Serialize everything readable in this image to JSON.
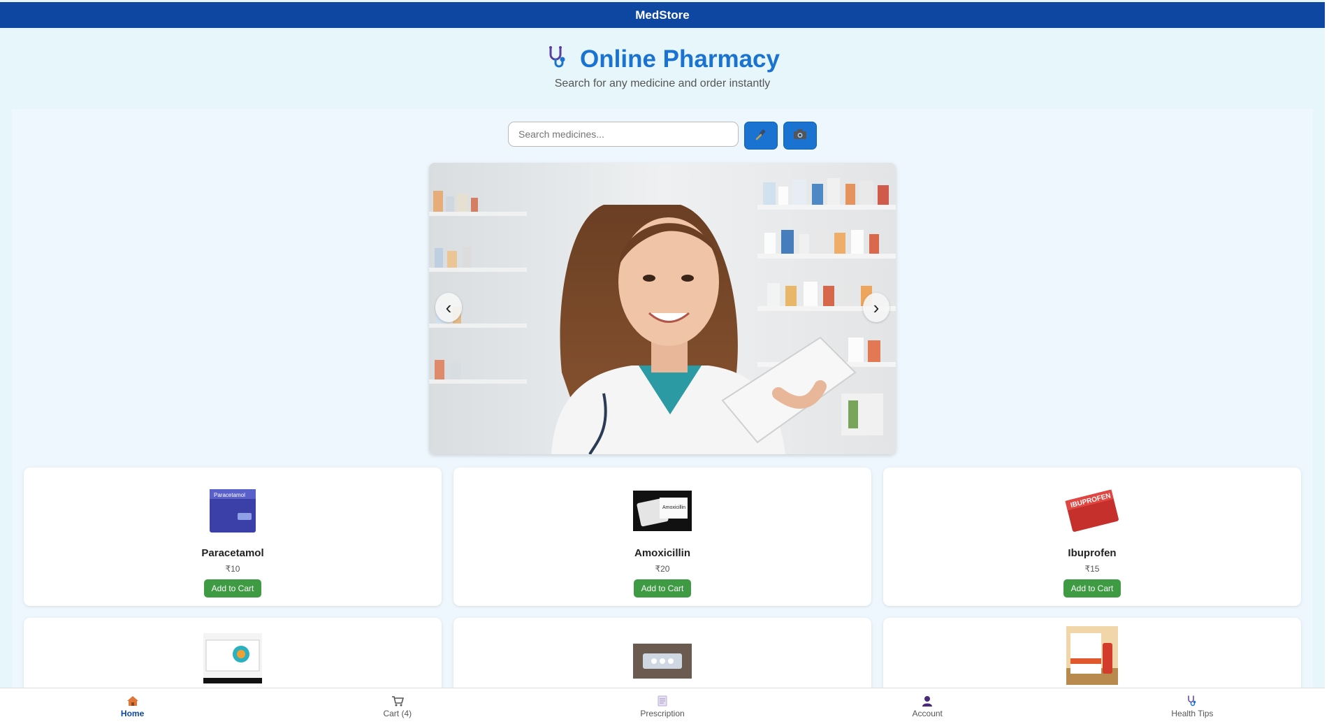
{
  "topbar": {
    "title": "MedStore"
  },
  "hero": {
    "title": "Online Pharmacy",
    "subtitle": "Search for any medicine and order instantly",
    "icon": "stethoscope-icon"
  },
  "search": {
    "placeholder": "Search medicines...",
    "voice_icon": "microphone-icon",
    "camera_icon": "camera-icon"
  },
  "carousel": {
    "prev_label": "‹",
    "next_label": "›",
    "image_subject": "smiling pharmacist in white coat holding clipboard in pharmacy aisle"
  },
  "products": [
    {
      "name": "Paracetamol",
      "price": "₹10",
      "button": "Add to Cart"
    },
    {
      "name": "Amoxicillin",
      "price": "₹20",
      "button": "Add to Cart"
    },
    {
      "name": "Ibuprofen",
      "price": "₹15",
      "button": "Add to Cart"
    },
    {
      "name": "",
      "price": "",
      "button": ""
    },
    {
      "name": "",
      "price": "",
      "button": ""
    },
    {
      "name": "",
      "price": "",
      "button": ""
    }
  ],
  "bottom_nav": [
    {
      "label": "Home",
      "icon": "home-icon",
      "active": true
    },
    {
      "label": "Cart (4)",
      "icon": "cart-icon",
      "active": false
    },
    {
      "label": "Prescription",
      "icon": "prescription-icon",
      "active": false
    },
    {
      "label": "Account",
      "icon": "account-icon",
      "active": false
    },
    {
      "label": "Health Tips",
      "icon": "stethoscope-icon",
      "active": false
    }
  ],
  "colors": {
    "primary": "#0e47a1",
    "accent": "#1a73d1",
    "add_button": "#3e9a43",
    "background": "#e6f6fb"
  }
}
